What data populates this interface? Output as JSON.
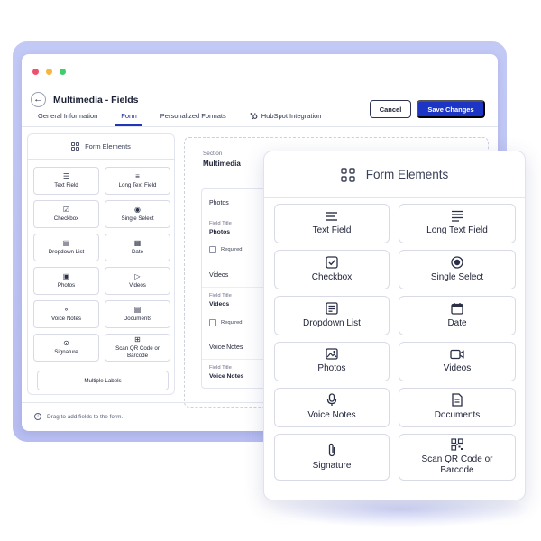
{
  "window": {
    "title": "Multimedia - Fields",
    "tabs": [
      {
        "label": "General Information"
      },
      {
        "label": "Form"
      },
      {
        "label": "Personalized Formats"
      },
      {
        "label": "HubSpot Integration"
      }
    ],
    "cancel_label": "Cancel",
    "save_label": "Save Changes",
    "dot_colors": [
      "#f0506e",
      "#f6b73c",
      "#3ccf6a"
    ],
    "accent": "#1c35c4"
  },
  "form_elements": {
    "heading": "Form Elements",
    "items": [
      {
        "label": "Text Field",
        "icon": "text-lines-icon"
      },
      {
        "label": "Long Text Field",
        "icon": "long-text-icon"
      },
      {
        "label": "Checkbox",
        "icon": "checkbox-icon"
      },
      {
        "label": "Single Select",
        "icon": "radio-icon"
      },
      {
        "label": "Dropdown List",
        "icon": "dropdown-list-icon"
      },
      {
        "label": "Date",
        "icon": "calendar-icon"
      },
      {
        "label": "Photos",
        "icon": "image-icon"
      },
      {
        "label": "Videos",
        "icon": "video-icon"
      },
      {
        "label": "Voice Notes",
        "icon": "microphone-icon"
      },
      {
        "label": "Documents",
        "icon": "document-icon"
      },
      {
        "label": "Signature",
        "icon": "paperclip-icon"
      },
      {
        "label": "Scan QR Code or Barcode",
        "icon": "qr-code-icon"
      }
    ],
    "multiple_labels": "Multiple Labels",
    "hint": "Drag to add fields to the form."
  },
  "section": {
    "label": "Section",
    "value": "Multimedia",
    "fields": [
      {
        "title": "Photos",
        "field_title_label": "Field Title",
        "field_title_value": "Photos",
        "required_label": "Required"
      },
      {
        "title": "Videos",
        "field_title_label": "Field Title",
        "field_title_value": "Videos",
        "required_label": "Required"
      },
      {
        "title": "Voice Notes",
        "field_title_label": "Field Title",
        "field_title_value": "Voice Notes"
      }
    ]
  }
}
